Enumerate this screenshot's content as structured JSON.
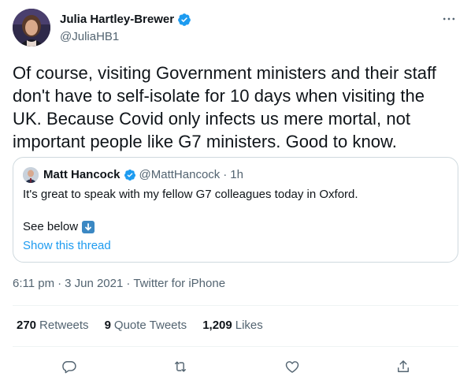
{
  "author": {
    "name": "Julia Hartley-Brewer",
    "handle": "@JuliaHB1"
  },
  "tweet": {
    "text": "Of course, visiting Government ministers and their staff don't have to self-isolate for 10 days when visiting the UK. Because Covid only infects us mere mortal, not important people like G7 ministers. Good to know."
  },
  "quoted": {
    "name": "Matt Hancock",
    "handle": "@MattHancock",
    "separator": "·",
    "time": "1h",
    "text": "It's great to speak with my fellow G7 colleagues today in Oxford.",
    "see_below": "See below",
    "show_thread": "Show this thread"
  },
  "meta": {
    "time": "6:11 pm",
    "dot1": "·",
    "date": "3 Jun 2021",
    "dot2": "·",
    "source": "Twitter for iPhone"
  },
  "stats": {
    "retweets_count": "270",
    "retweets_label": "Retweets",
    "quotes_count": "9",
    "quotes_label": "Quote Tweets",
    "likes_count": "1,209",
    "likes_label": "Likes"
  },
  "icons": {
    "verified": "verified-badge-icon",
    "more": "more-options-icon",
    "reply": "reply-icon",
    "retweet": "retweet-icon",
    "like": "heart-icon",
    "share": "share-icon",
    "emoji": "down-arrow-emoji-icon"
  },
  "colors": {
    "accent": "#1d9bf0",
    "secondary_text": "#536471",
    "primary_text": "#0f1419",
    "border": "#cfd9de"
  }
}
